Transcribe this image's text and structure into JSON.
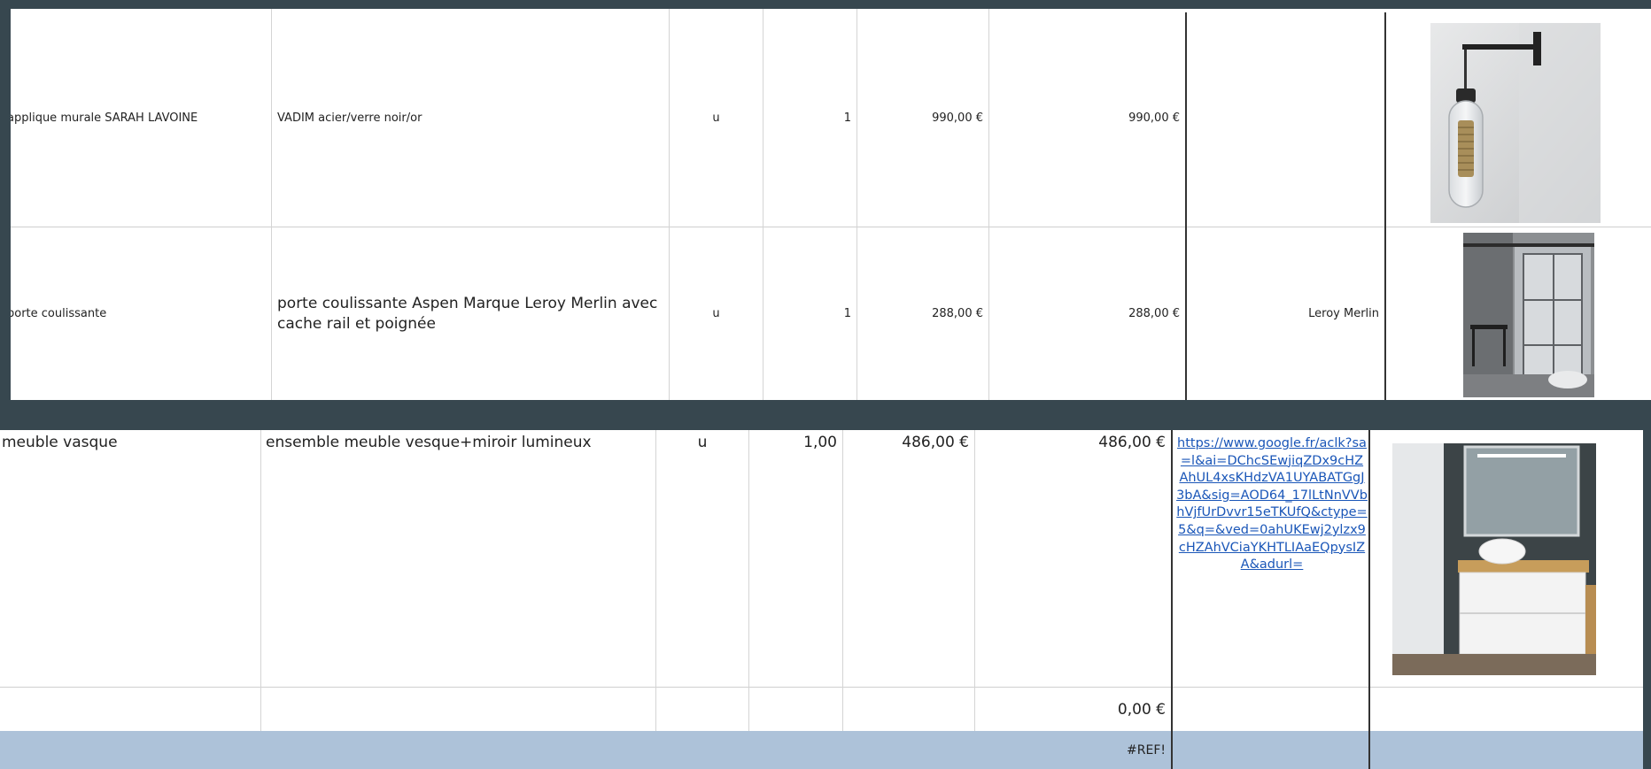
{
  "rows_top": [
    {
      "item": "applique murale SARAH LAVOINE",
      "description": "VADIM acier/verre noir/or",
      "unit": "u",
      "quantity": "1",
      "unit_price": "990,00 €",
      "total": "990,00 €",
      "supplier": "",
      "image": "wall-lamp-photo"
    },
    {
      "item": "porte coulissante",
      "description": "porte coulissante Aspen Marque Leroy Merlin avec cache rail et poignée",
      "unit": "u",
      "quantity": "1",
      "unit_price": "288,00 €",
      "total": "288,00 €",
      "supplier": "Leroy Merlin",
      "image": "sliding-door-photo"
    }
  ],
  "row_bottom": {
    "item": "meuble vasque",
    "description": "ensemble meuble vesque+miroir lumineux",
    "unit": "u",
    "quantity": "1,00",
    "unit_price": "486,00 €",
    "total": "486,00 €",
    "link": "https://www.google.fr/aclk?sa=l&ai=DChcSEwjiqZDx9cHZAhUL4xsKHdzVA1UYABATGgJ3bA&sig=AOD64_17lLtNnVVbhVjfUrDvvr15eTKUfQ&ctype=5&q=&ved=0ahUKEwj2ylzx9cHZAhVCiaYKHTLIAaEQpysIZA&adurl=",
    "image": "vanity-unit-photo"
  },
  "empty_row_total": "0,00 €",
  "summary_row_value": "#REF!"
}
